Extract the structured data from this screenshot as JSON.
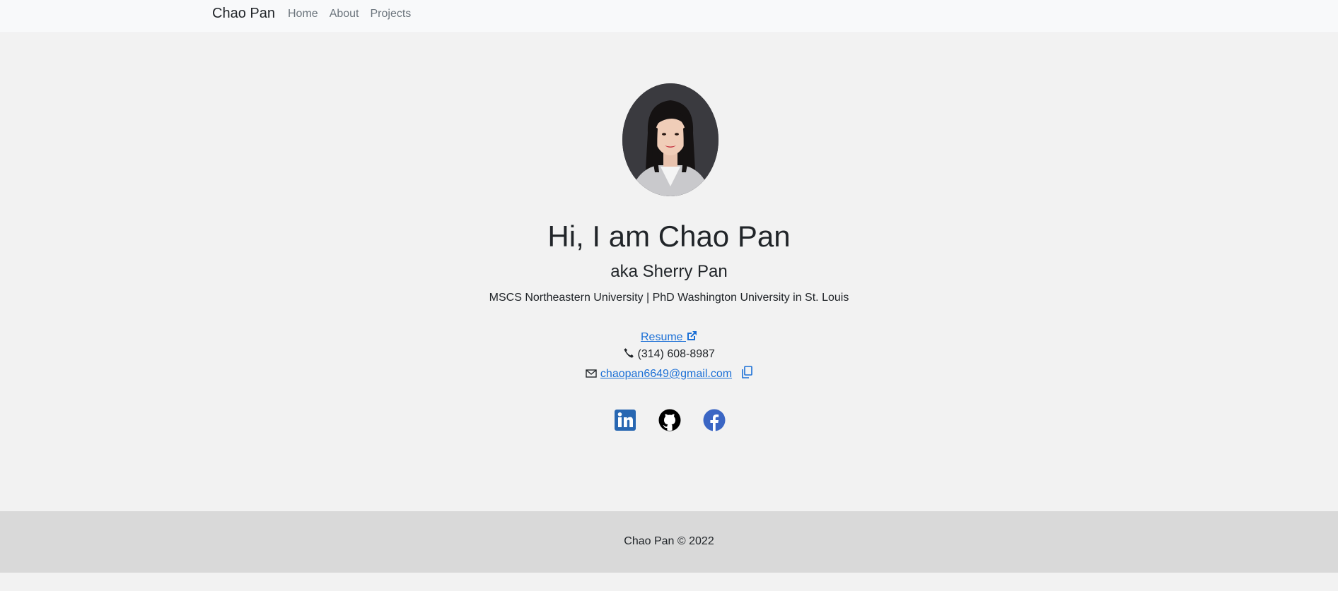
{
  "navbar": {
    "brand": "Chao Pan",
    "links": [
      "Home",
      "About",
      "Projects"
    ]
  },
  "profile": {
    "avatar_icon": "profile-photo",
    "headline": "Hi, I am Chao Pan",
    "aka": "aka Sherry Pan",
    "degrees": "MSCS Northeastern University | PhD Washington University in St. Louis"
  },
  "contact": {
    "resume_label": "Resume",
    "resume_icon": "external-link-icon",
    "phone_icon": "phone-icon",
    "phone": "(314) 608-8987",
    "email_icon": "envelope-icon",
    "email": "chaopan6649@gmail.com",
    "copy_icon": "copy-icon"
  },
  "socials": [
    {
      "name": "linkedin-icon",
      "color": "#2867b2"
    },
    {
      "name": "github-icon",
      "color": "#000000"
    },
    {
      "name": "facebook-icon",
      "color": "#3b66c4"
    }
  ],
  "footer": {
    "text": "Chao Pan © 2022"
  },
  "colors": {
    "link": "#1a6fd6",
    "background": "#f2f2f2",
    "footer_bg": "#d9d9d9"
  }
}
